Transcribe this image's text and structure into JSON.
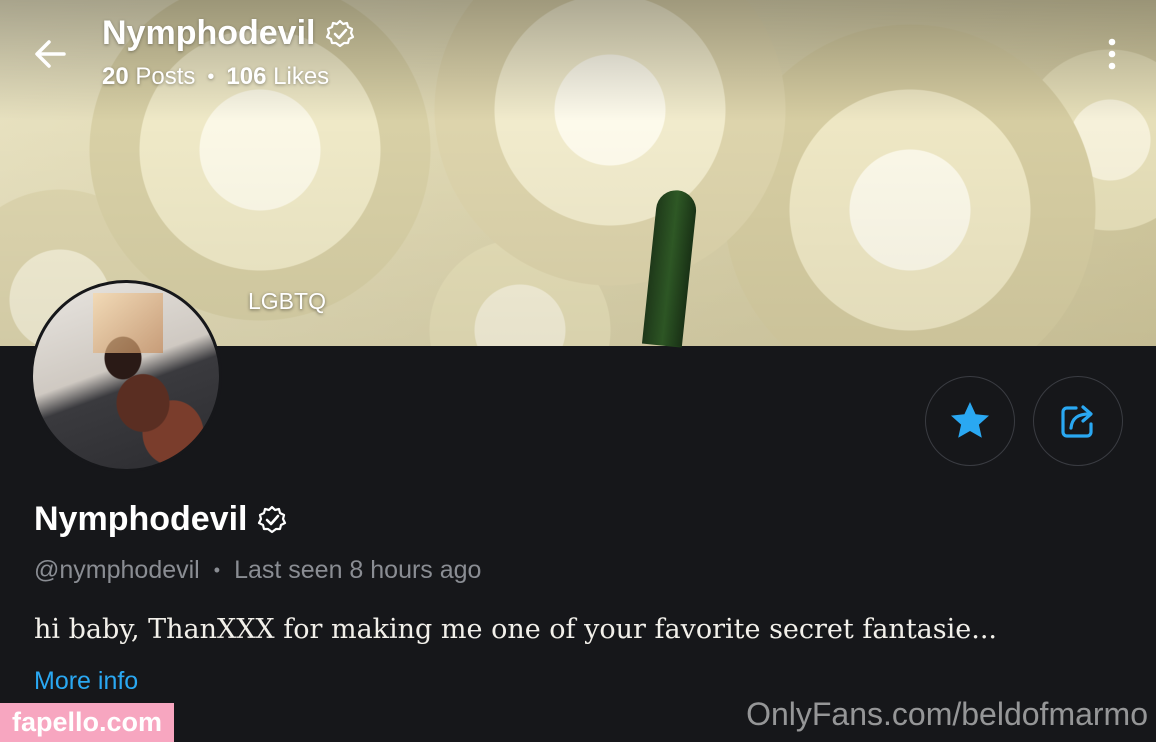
{
  "header": {
    "title": "Nymphodevil",
    "posts_count": "20",
    "posts_label": "Posts",
    "likes_count": "106",
    "likes_label": "Likes",
    "separator": "•"
  },
  "cover": {
    "tag": "LGBTQ"
  },
  "profile": {
    "name": "Nymphodevil",
    "handle": "@nymphodevil",
    "separator": "•",
    "last_seen": "Last seen 8 hours ago",
    "bio": "hi baby, ThanXXX for making me one of your favorite secret fantasie...",
    "more_info": "More info"
  },
  "icons": {
    "back": "arrow-left-icon",
    "verified": "verified-badge-icon",
    "more": "more-vertical-icon",
    "favorite": "star-icon",
    "share": "share-icon"
  },
  "watermarks": {
    "left": "fapello.com",
    "right": "OnlyFans.com/beldofmarmo"
  },
  "colors": {
    "accent": "#00aff0",
    "background": "#16171a",
    "watermark_left_bg": "#f7a6c0"
  }
}
